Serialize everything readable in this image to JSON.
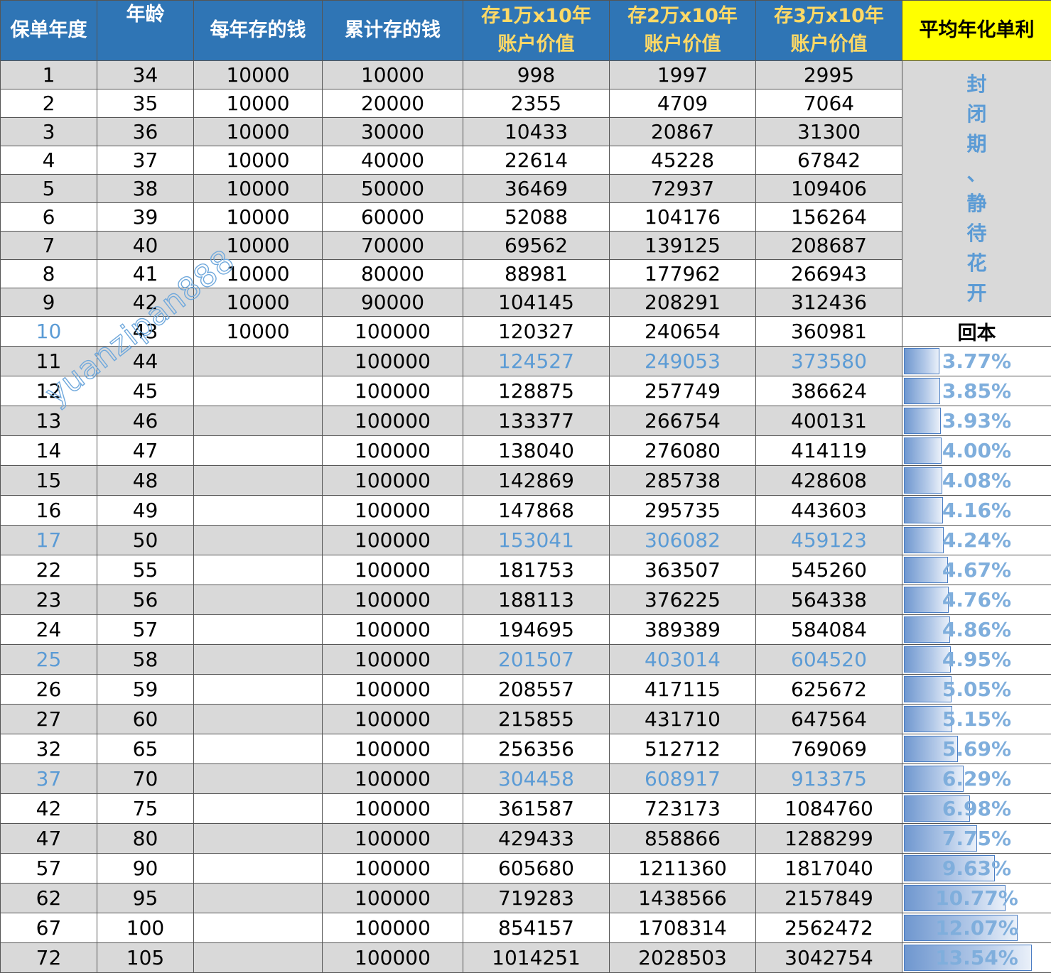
{
  "headers": {
    "year": "保单年度",
    "age": "年龄",
    "annual": "每年存的钱",
    "cumulative": "累计存的钱",
    "v1_line1": "存1万x10年",
    "v1_line2": "账户价值",
    "v2_line1": "存2万x10年",
    "v2_line2": "账户价值",
    "v3_line1": "存3万x10年",
    "v3_line2": "账户价值",
    "rate": "平均年化单利"
  },
  "side_note_chars": [
    "封",
    "闭",
    "期",
    "、",
    "静",
    "待",
    "花",
    "开"
  ],
  "payback_label": "回本",
  "watermark": "yuanzipan888",
  "rows": [
    {
      "year": "1",
      "age": "34",
      "annual": "10000",
      "cum": "10000",
      "v1": "998",
      "v2": "1997",
      "v3": "2995"
    },
    {
      "year": "2",
      "age": "35",
      "annual": "10000",
      "cum": "20000",
      "v1": "2355",
      "v2": "4709",
      "v3": "7064"
    },
    {
      "year": "3",
      "age": "36",
      "annual": "10000",
      "cum": "30000",
      "v1": "10433",
      "v2": "20867",
      "v3": "31300"
    },
    {
      "year": "4",
      "age": "37",
      "annual": "10000",
      "cum": "40000",
      "v1": "22614",
      "v2": "45228",
      "v3": "67842"
    },
    {
      "year": "5",
      "age": "38",
      "annual": "10000",
      "cum": "50000",
      "v1": "36469",
      "v2": "72937",
      "v3": "109406"
    },
    {
      "year": "6",
      "age": "39",
      "annual": "10000",
      "cum": "60000",
      "v1": "52088",
      "v2": "104176",
      "v3": "156264"
    },
    {
      "year": "7",
      "age": "40",
      "annual": "10000",
      "cum": "70000",
      "v1": "69562",
      "v2": "139125",
      "v3": "208687"
    },
    {
      "year": "8",
      "age": "41",
      "annual": "10000",
      "cum": "80000",
      "v1": "88981",
      "v2": "177962",
      "v3": "266943"
    },
    {
      "year": "9",
      "age": "42",
      "annual": "10000",
      "cum": "90000",
      "v1": "104145",
      "v2": "208291",
      "v3": "312436"
    },
    {
      "year": "10",
      "age": "43",
      "annual": "10000",
      "cum": "100000",
      "v1": "120327",
      "v2": "240654",
      "v3": "360981"
    },
    {
      "year": "11",
      "age": "44",
      "annual": "",
      "cum": "100000",
      "v1": "124527",
      "v2": "249053",
      "v3": "373580",
      "rate": "3.77%",
      "rate_value": 3.77
    },
    {
      "year": "12",
      "age": "45",
      "annual": "",
      "cum": "100000",
      "v1": "128875",
      "v2": "257749",
      "v3": "386624",
      "rate": "3.85%",
      "rate_value": 3.85
    },
    {
      "year": "13",
      "age": "46",
      "annual": "",
      "cum": "100000",
      "v1": "133377",
      "v2": "266754",
      "v3": "400131",
      "rate": "3.93%",
      "rate_value": 3.93
    },
    {
      "year": "14",
      "age": "47",
      "annual": "",
      "cum": "100000",
      "v1": "138040",
      "v2": "276080",
      "v3": "414119",
      "rate": "4.00%",
      "rate_value": 4.0
    },
    {
      "year": "15",
      "age": "48",
      "annual": "",
      "cum": "100000",
      "v1": "142869",
      "v2": "285738",
      "v3": "428608",
      "rate": "4.08%",
      "rate_value": 4.08
    },
    {
      "year": "16",
      "age": "49",
      "annual": "",
      "cum": "100000",
      "v1": "147868",
      "v2": "295735",
      "v3": "443603",
      "rate": "4.16%",
      "rate_value": 4.16
    },
    {
      "year": "17",
      "age": "50",
      "annual": "",
      "cum": "100000",
      "v1": "153041",
      "v2": "306082",
      "v3": "459123",
      "rate": "4.24%",
      "rate_value": 4.24
    },
    {
      "year": "22",
      "age": "55",
      "annual": "",
      "cum": "100000",
      "v1": "181753",
      "v2": "363507",
      "v3": "545260",
      "rate": "4.67%",
      "rate_value": 4.67
    },
    {
      "year": "23",
      "age": "56",
      "annual": "",
      "cum": "100000",
      "v1": "188113",
      "v2": "376225",
      "v3": "564338",
      "rate": "4.76%",
      "rate_value": 4.76
    },
    {
      "year": "24",
      "age": "57",
      "annual": "",
      "cum": "100000",
      "v1": "194695",
      "v2": "389389",
      "v3": "584084",
      "rate": "4.86%",
      "rate_value": 4.86
    },
    {
      "year": "25",
      "age": "58",
      "annual": "",
      "cum": "100000",
      "v1": "201507",
      "v2": "403014",
      "v3": "604520",
      "rate": "4.95%",
      "rate_value": 4.95
    },
    {
      "year": "26",
      "age": "59",
      "annual": "",
      "cum": "100000",
      "v1": "208557",
      "v2": "417115",
      "v3": "625672",
      "rate": "5.05%",
      "rate_value": 5.05
    },
    {
      "year": "27",
      "age": "60",
      "annual": "",
      "cum": "100000",
      "v1": "215855",
      "v2": "431710",
      "v3": "647564",
      "rate": "5.15%",
      "rate_value": 5.15
    },
    {
      "year": "32",
      "age": "65",
      "annual": "",
      "cum": "100000",
      "v1": "256356",
      "v2": "512712",
      "v3": "769069",
      "rate": "5.69%",
      "rate_value": 5.69
    },
    {
      "year": "37",
      "age": "70",
      "annual": "",
      "cum": "100000",
      "v1": "304458",
      "v2": "608917",
      "v3": "913375",
      "rate": "6.29%",
      "rate_value": 6.29
    },
    {
      "year": "42",
      "age": "75",
      "annual": "",
      "cum": "100000",
      "v1": "361587",
      "v2": "723173",
      "v3": "1084760",
      "rate": "6.98%",
      "rate_value": 6.98
    },
    {
      "year": "47",
      "age": "80",
      "annual": "",
      "cum": "100000",
      "v1": "429433",
      "v2": "858866",
      "v3": "1288299",
      "rate": "7.75%",
      "rate_value": 7.75
    },
    {
      "year": "57",
      "age": "90",
      "annual": "",
      "cum": "100000",
      "v1": "605680",
      "v2": "1211360",
      "v3": "1817040",
      "rate": "9.63%",
      "rate_value": 9.63
    },
    {
      "year": "62",
      "age": "95",
      "annual": "",
      "cum": "100000",
      "v1": "719283",
      "v2": "1438566",
      "v3": "2157849",
      "rate": "10.77%",
      "rate_value": 10.77
    },
    {
      "year": "67",
      "age": "100",
      "annual": "",
      "cum": "100000",
      "v1": "854157",
      "v2": "1708314",
      "v3": "2562472",
      "rate": "12.07%",
      "rate_value": 12.07
    },
    {
      "year": "72",
      "age": "105",
      "annual": "",
      "cum": "100000",
      "v1": "1014251",
      "v2": "2028503",
      "v3": "3042754",
      "rate": "13.54%",
      "rate_value": 13.54
    }
  ],
  "highlight_years": [
    "10",
    "17",
    "25",
    "37"
  ],
  "highlight_value_years": [
    "11",
    "17",
    "25",
    "37"
  ],
  "colors": {
    "header_bg": "#2f75b5",
    "header_gold_text": "#ffd966",
    "rate_header_bg": "#ffff00",
    "shade_row": "#d9d9d9",
    "highlight_text": "#5b9bd5"
  }
}
